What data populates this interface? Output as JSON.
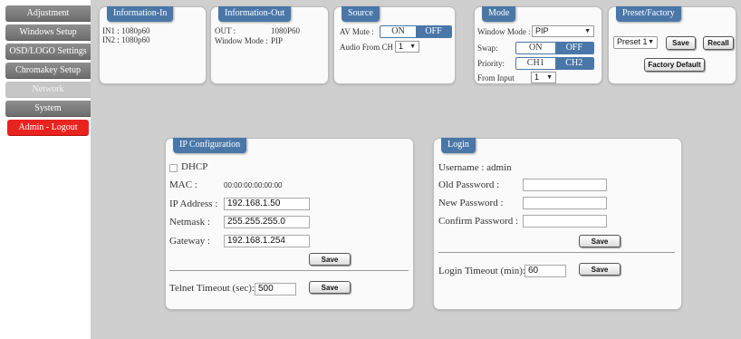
{
  "nav": {
    "adjustment": "Adjustment",
    "windows_setup": "Windows Setup",
    "osd_logo": "OSD/LOGO Settings",
    "chromakey": "Chromakey Setup",
    "network": "Network",
    "system": "System",
    "logout": "Admin - Logout"
  },
  "info_in": {
    "title": "Information-In",
    "in1": "IN1 : 1080p60",
    "in2": "IN2 : 1080p60"
  },
  "info_out": {
    "title": "Information-Out",
    "out_label": "OUT :",
    "out_value": "1080P60",
    "window_mode_label": "Window Mode :",
    "window_mode_value": "PIP"
  },
  "source": {
    "title": "Source",
    "av_mute_label": "AV Mute :",
    "on": "ON",
    "off": "OFF",
    "audio_label": "Audio From CH",
    "audio_value": "1"
  },
  "mode": {
    "title": "Mode",
    "window_mode_label": "Window Mode :",
    "window_mode_value": "PIP",
    "swap_label": "Swap:",
    "on": "ON",
    "off": "OFF",
    "priority_label": "Priority:",
    "ch1": "CH1",
    "ch2": "CH2",
    "from_input_label": "From Input",
    "from_input_value": "1"
  },
  "preset": {
    "title": "Preset/Factory",
    "preset_value": "Preset 1",
    "save": "Save",
    "recall": "Recall",
    "factory_default": "Factory Default"
  },
  "ip": {
    "title": "IP Configuration",
    "dhcp": "DHCP",
    "mac_label": "MAC :",
    "mac_value": "00:00:00:00:00:00",
    "ip_label": "IP Address :",
    "ip_value": "192.168.1.50",
    "netmask_label": "Netmask :",
    "netmask_value": "255.255.255.0",
    "gateway_label": "Gateway :",
    "gateway_value": "192.168.1.254",
    "save": "Save",
    "telnet_label": "Telnet Timeout (sec):",
    "telnet_value": "500",
    "telnet_save": "Save"
  },
  "login": {
    "title": "Login",
    "username": "Username : admin",
    "old_pw_label": "Old Password :",
    "new_pw_label": "New Password :",
    "confirm_pw_label": "Confirm Password :",
    "save": "Save",
    "timeout_label": "Login Timeout (min):",
    "timeout_value": "60",
    "timeout_save": "Save"
  },
  "colors": {
    "accent": "#4a77a8",
    "logout": "#e8241f",
    "nav_gray": "#7d7d7d",
    "background": "#cfcfcf"
  }
}
